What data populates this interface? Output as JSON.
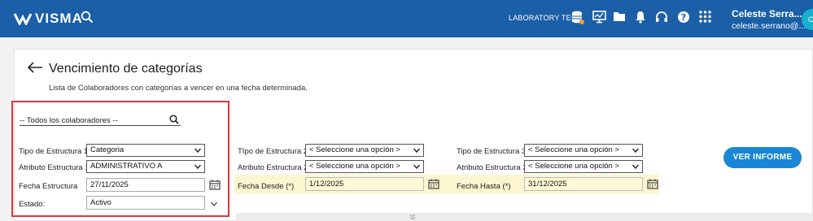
{
  "topbar": {
    "brand": "VISMA",
    "environment": "LABORATORY TEST",
    "user_name": "Celeste Serra...",
    "user_email": "celeste.serrano@...",
    "avatar_initial": "C",
    "color": "#1a5fa8"
  },
  "page": {
    "title": "Vencimiento de categorías",
    "subtitle": "Lista de Colaboradores con categorías a vencer en una fecha determinada."
  },
  "filters": {
    "collaborators": "-- Todos los colaboradores --",
    "col1": {
      "tipo_label": "Tipo de Estructura 1",
      "tipo_value": "Categoria",
      "atributo_label": "Atributo Estructura 1",
      "atributo_value": "ADMINISTRATIVO A",
      "fecha_label": "Fecha Estructura",
      "fecha_value": "27/11/2025",
      "estado_label": "Estado:",
      "estado_value": "Activo"
    },
    "col2": {
      "tipo_label": "TIpo de Estructura 2",
      "tipo_value": "< Seleccione una opción >",
      "atributo_label": "Atributo Estructura 2",
      "atributo_value": "< Seleccione una opción >",
      "fecha_label": "Fecha Desde (*)",
      "fecha_value": "1/12/2025"
    },
    "col3": {
      "tipo_label": "Tipo de Estructura 3",
      "tipo_value": "< Seleccione una opción >",
      "atributo_label": "Atributo Estructura 3",
      "atributo_value": "< Seleccione una opción >",
      "fecha_label": "Fecha Hasta (*)",
      "fecha_value": "31/12/2025"
    }
  },
  "actions": {
    "report_label": "VER INFORME"
  },
  "colors": {
    "accent": "#1a86d6",
    "highlight": "#e0353b",
    "required_bg": "#fbf6d0"
  }
}
